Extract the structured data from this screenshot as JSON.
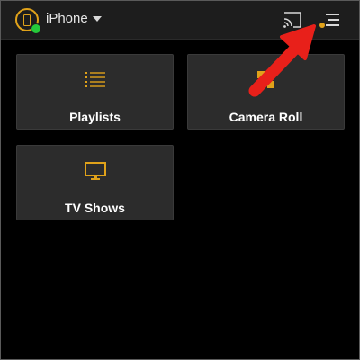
{
  "header": {
    "device_name": "iPhone",
    "device_icon": "phone-icon",
    "cast_icon": "cast-icon",
    "menu_icon": "menu-icon",
    "status_color": "#25c93a",
    "accent_color": "#e0a21a"
  },
  "tiles": [
    {
      "label": "Playlists",
      "icon": "list-icon"
    },
    {
      "label": "Camera Roll",
      "icon": "grid-icon"
    },
    {
      "label": "TV Shows",
      "icon": "tv-icon"
    }
  ],
  "annotation": {
    "arrow_color": "#e8201a"
  }
}
